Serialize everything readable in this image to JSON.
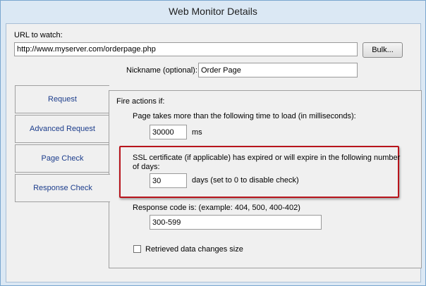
{
  "window": {
    "title": "Web Monitor Details"
  },
  "url": {
    "label": "URL to watch:",
    "value": "http://www.myserver.com/orderpage.php",
    "bulk_button": "Bulk..."
  },
  "nickname": {
    "label": "Nickname (optional):",
    "value": "Order Page"
  },
  "tabs": [
    {
      "label": "Request"
    },
    {
      "label": "Advanced Request"
    },
    {
      "label": "Page Check"
    },
    {
      "label": "Response Check"
    }
  ],
  "panel": {
    "fire_label": "Fire actions if:",
    "load_time_label": "Page takes more than the following time to load (in milliseconds):",
    "load_time_value": "30000",
    "load_time_unit": "ms",
    "ssl_label_line1": "SSL certificate (if applicable) has expired or will expire in the following number",
    "ssl_label_line2": "of days:",
    "ssl_value": "30",
    "ssl_unit": "days (set to 0 to disable check)",
    "response_label": "Response code is:  (example: 404, 500, 400-402)",
    "response_value": "300-599",
    "changes_label": "Retrieved data changes size",
    "changes_checked": false
  },
  "colors": {
    "highlight": "#b8141c",
    "tab_text": "#1c3d8c"
  }
}
